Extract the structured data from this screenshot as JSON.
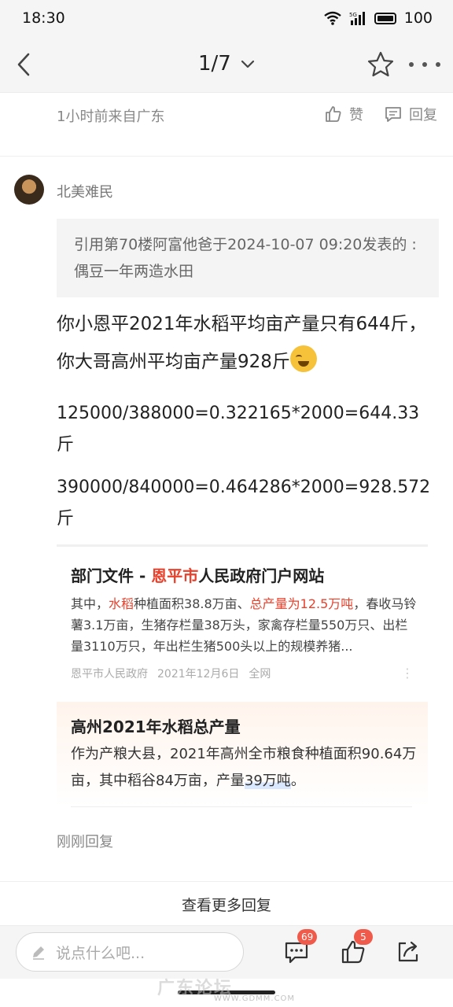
{
  "status_bar": {
    "time": "18:30",
    "battery": "100",
    "network": "5G"
  },
  "nav": {
    "page_indicator": "1/7"
  },
  "previous_comment": {
    "meta": "1小时前来自广东",
    "like_label": "赞",
    "reply_label": "回复"
  },
  "comment": {
    "username": "北美难民",
    "quote": "引用第70楼阿富他爸于2024-10-07 09:20发表的  :偶豆一年两造水田",
    "text": "你小恩平2021年水稻平均亩产量只有644斤，你大哥高州平均亩产量928斤",
    "calc_1": "125000/388000=0.322165*2000=644.33斤",
    "calc_2": "390000/840000=0.464286*2000=928.572斤",
    "time": "刚刚回复"
  },
  "card_1": {
    "title_prefix": "部门文件 - ",
    "title_highlight": "恩平市",
    "title_suffix": "人民政府门户网站",
    "body_1": "其中，",
    "body_hl_1": "水稻",
    "body_2": "种植面积38.8万亩、",
    "body_hl_2": "总产量为12.5万吨",
    "body_3": "，春收马铃薯3.1万亩，生猪存栏量38万头，家禽存栏量550万只、出栏量3110万只，年出栏生猪500头以上的规模养猪...",
    "source": "恩平市人民政府",
    "date": "2021年12月6日",
    "scope": "全网"
  },
  "card_2": {
    "title": "高州2021年水稻总产量",
    "body_1": "作为产粮大县，2021年高州全市粮食种植面积90.64万亩，其中稻谷84万亩，产量",
    "body_hl": "39万吨",
    "body_2": "。"
  },
  "more_replies": "查看更多回复",
  "bottom_bar": {
    "placeholder": "说点什么吧...",
    "comment_count": "69",
    "like_count": "5"
  },
  "watermark": {
    "main": "广东论坛",
    "sub": "WWW.GDMM.COM"
  }
}
